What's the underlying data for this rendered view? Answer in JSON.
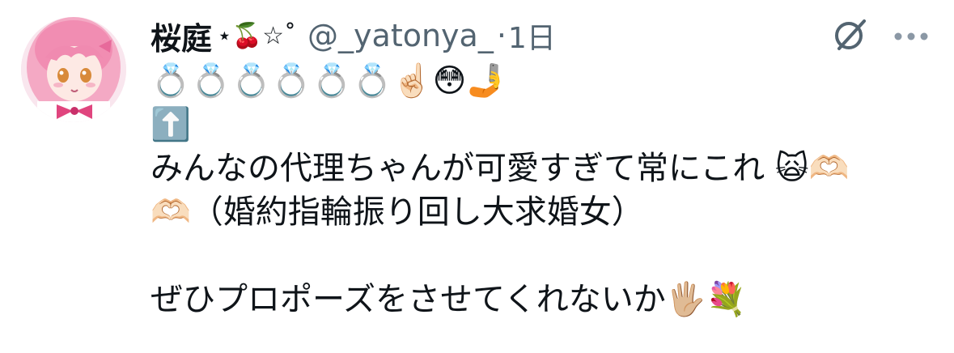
{
  "author": {
    "display_name": "桜庭",
    "name_decoration": "⋆🍒☆˚",
    "handle": "@_yatonya_",
    "separator": "·",
    "time": "1日"
  },
  "icons": {
    "grok": "grok-icon",
    "more": "more-options-icon",
    "avatar": "anime-avatar"
  },
  "tweet": {
    "line1": "💍💍💍💍💍💍☝🏻😳🤳",
    "line2": "⬆️",
    "line3": "みんなの代理ちゃんが可愛すぎて常にこれ 🙀🫶🏻",
    "line4": "🫶🏻（婚約指輪振り回し大求婚女）",
    "line5": "ぜひプロポーズをさせてくれないか🖐🏼💐"
  },
  "colors": {
    "text": "#0f1419",
    "secondary": "#536471",
    "background": "#ffffff"
  }
}
